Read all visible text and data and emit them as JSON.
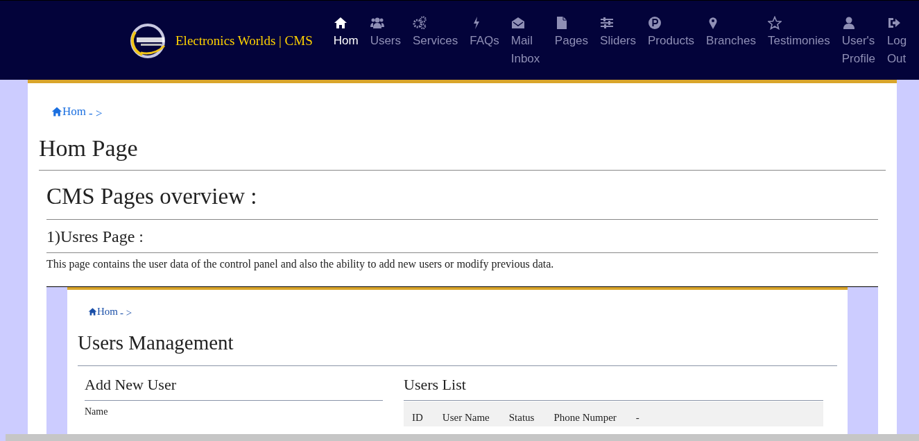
{
  "brand": {
    "title": "Electronics Worlds | CMS"
  },
  "nav": [
    {
      "label": "Hom",
      "selected": true
    },
    {
      "label": "Users",
      "selected": false
    },
    {
      "label": "Services",
      "selected": false
    },
    {
      "label": "FAQs",
      "selected": false
    },
    {
      "label": "Mail Inbox",
      "selected": false
    },
    {
      "label": "Pages",
      "selected": false
    },
    {
      "label": "Sliders",
      "selected": false
    },
    {
      "label": "Products",
      "selected": false
    },
    {
      "label": "Branches",
      "selected": false
    },
    {
      "label": "Testimonies",
      "selected": false
    },
    {
      "label": "User's Profile",
      "selected": false
    },
    {
      "label": "Log Out",
      "selected": false
    }
  ],
  "breadcrumb": {
    "link": "Hom",
    "separator": "- >"
  },
  "page_title": "Hom Page",
  "overview": {
    "heading": "CMS Pages overview :",
    "sections": [
      {
        "heading": "1)Usres Page :",
        "text": "This page contains the user data of the control panel and also the ability to add new users or modify previous data.",
        "preview": {
          "breadcrumb": {
            "link": "Hom",
            "separator": "- >"
          },
          "title": "Users Management",
          "form": {
            "heading": "Add New User",
            "fields": [
              {
                "label": "Name"
              }
            ]
          },
          "list": {
            "heading": "Users List",
            "columns": [
              "ID",
              "User Name",
              "Status",
              "Phone Numper",
              "-"
            ]
          }
        }
      }
    ]
  }
}
